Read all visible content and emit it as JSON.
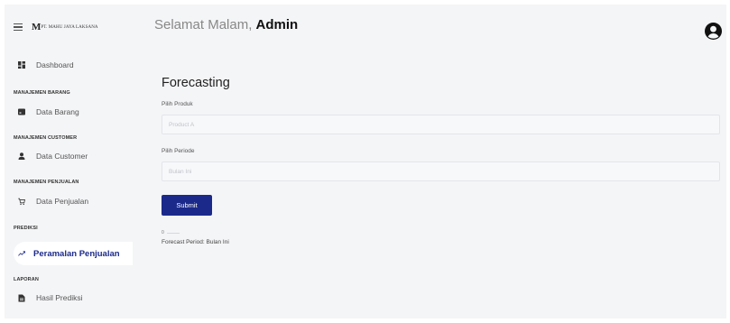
{
  "brand": {
    "logo_mark": "M",
    "name": "PT. MAHU JAYA LAKSANA"
  },
  "header": {
    "greeting_prefix": "Selamat Malam, ",
    "greeting_user": "Admin"
  },
  "sidebar": {
    "dashboard": "Dashboard",
    "sections": [
      {
        "title": "MANAJEMEN BARANG",
        "item": "Data Barang"
      },
      {
        "title": "MANAJEMEN CUSTOMER",
        "item": "Data Customer"
      },
      {
        "title": "MANAJEMEN PENJUALAN",
        "item": "Data Penjualan"
      },
      {
        "title": "PREDIKSI",
        "item": "Peramalan Penjualan"
      },
      {
        "title": "LAPORAN",
        "item": "Hasil Prediksi"
      }
    ],
    "active_item": "Peramalan Penjualan"
  },
  "form": {
    "title": "Forecasting",
    "product_label": "Pilih Produk",
    "product_value": "Product A",
    "period_label": "Pilih Periode",
    "period_value": "Bulan Ini",
    "submit_label": "Submit"
  },
  "result": {
    "chart_value": "0",
    "text": "Forecast Period: Bulan Ini"
  },
  "colors": {
    "primary": "#1b2a8a",
    "background": "#f4f5f7"
  }
}
